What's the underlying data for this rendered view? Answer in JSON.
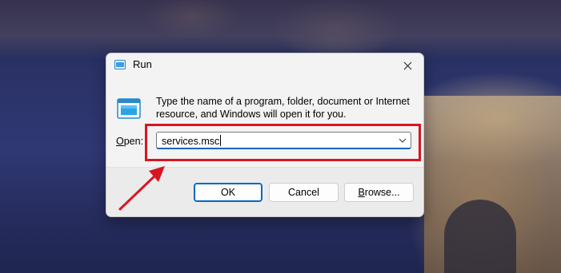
{
  "window": {
    "title": "Run",
    "description": "Type the name of a program, folder, document or Internet resource, and Windows will open it for you.",
    "open_label_accel": "O",
    "open_label_rest": "pen:",
    "open_value": "services.msc"
  },
  "buttons": {
    "ok": "OK",
    "cancel": "Cancel",
    "browse_accel": "B",
    "browse_rest": "rowse..."
  },
  "icons": {
    "title": "run-app-icon",
    "body": "run-app-icon",
    "close": "close-icon",
    "dropdown": "chevron-down-icon",
    "annotation": "red-arrow-icon"
  },
  "colors": {
    "accent": "#0067c0",
    "highlight": "#d7161f",
    "dialog_bg": "#f3f3f3"
  }
}
